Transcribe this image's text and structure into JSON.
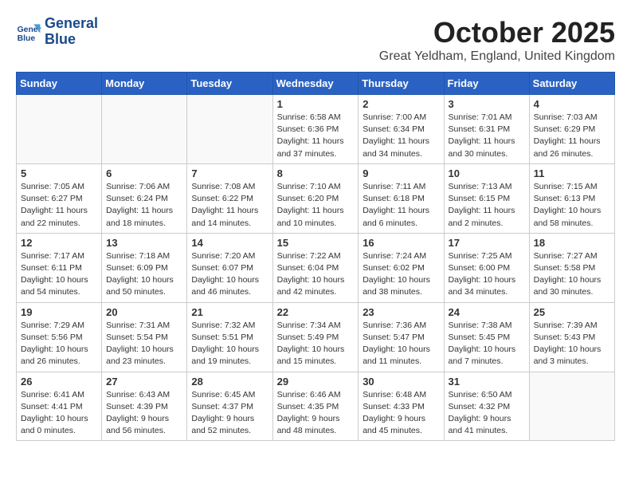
{
  "header": {
    "logo_line1": "General",
    "logo_line2": "Blue",
    "month": "October 2025",
    "location": "Great Yeldham, England, United Kingdom"
  },
  "weekdays": [
    "Sunday",
    "Monday",
    "Tuesday",
    "Wednesday",
    "Thursday",
    "Friday",
    "Saturday"
  ],
  "weeks": [
    [
      {
        "day": "",
        "info": ""
      },
      {
        "day": "",
        "info": ""
      },
      {
        "day": "",
        "info": ""
      },
      {
        "day": "1",
        "info": "Sunrise: 6:58 AM\nSunset: 6:36 PM\nDaylight: 11 hours\nand 37 minutes."
      },
      {
        "day": "2",
        "info": "Sunrise: 7:00 AM\nSunset: 6:34 PM\nDaylight: 11 hours\nand 34 minutes."
      },
      {
        "day": "3",
        "info": "Sunrise: 7:01 AM\nSunset: 6:31 PM\nDaylight: 11 hours\nand 30 minutes."
      },
      {
        "day": "4",
        "info": "Sunrise: 7:03 AM\nSunset: 6:29 PM\nDaylight: 11 hours\nand 26 minutes."
      }
    ],
    [
      {
        "day": "5",
        "info": "Sunrise: 7:05 AM\nSunset: 6:27 PM\nDaylight: 11 hours\nand 22 minutes."
      },
      {
        "day": "6",
        "info": "Sunrise: 7:06 AM\nSunset: 6:24 PM\nDaylight: 11 hours\nand 18 minutes."
      },
      {
        "day": "7",
        "info": "Sunrise: 7:08 AM\nSunset: 6:22 PM\nDaylight: 11 hours\nand 14 minutes."
      },
      {
        "day": "8",
        "info": "Sunrise: 7:10 AM\nSunset: 6:20 PM\nDaylight: 11 hours\nand 10 minutes."
      },
      {
        "day": "9",
        "info": "Sunrise: 7:11 AM\nSunset: 6:18 PM\nDaylight: 11 hours\nand 6 minutes."
      },
      {
        "day": "10",
        "info": "Sunrise: 7:13 AM\nSunset: 6:15 PM\nDaylight: 11 hours\nand 2 minutes."
      },
      {
        "day": "11",
        "info": "Sunrise: 7:15 AM\nSunset: 6:13 PM\nDaylight: 10 hours\nand 58 minutes."
      }
    ],
    [
      {
        "day": "12",
        "info": "Sunrise: 7:17 AM\nSunset: 6:11 PM\nDaylight: 10 hours\nand 54 minutes."
      },
      {
        "day": "13",
        "info": "Sunrise: 7:18 AM\nSunset: 6:09 PM\nDaylight: 10 hours\nand 50 minutes."
      },
      {
        "day": "14",
        "info": "Sunrise: 7:20 AM\nSunset: 6:07 PM\nDaylight: 10 hours\nand 46 minutes."
      },
      {
        "day": "15",
        "info": "Sunrise: 7:22 AM\nSunset: 6:04 PM\nDaylight: 10 hours\nand 42 minutes."
      },
      {
        "day": "16",
        "info": "Sunrise: 7:24 AM\nSunset: 6:02 PM\nDaylight: 10 hours\nand 38 minutes."
      },
      {
        "day": "17",
        "info": "Sunrise: 7:25 AM\nSunset: 6:00 PM\nDaylight: 10 hours\nand 34 minutes."
      },
      {
        "day": "18",
        "info": "Sunrise: 7:27 AM\nSunset: 5:58 PM\nDaylight: 10 hours\nand 30 minutes."
      }
    ],
    [
      {
        "day": "19",
        "info": "Sunrise: 7:29 AM\nSunset: 5:56 PM\nDaylight: 10 hours\nand 26 minutes."
      },
      {
        "day": "20",
        "info": "Sunrise: 7:31 AM\nSunset: 5:54 PM\nDaylight: 10 hours\nand 23 minutes."
      },
      {
        "day": "21",
        "info": "Sunrise: 7:32 AM\nSunset: 5:51 PM\nDaylight: 10 hours\nand 19 minutes."
      },
      {
        "day": "22",
        "info": "Sunrise: 7:34 AM\nSunset: 5:49 PM\nDaylight: 10 hours\nand 15 minutes."
      },
      {
        "day": "23",
        "info": "Sunrise: 7:36 AM\nSunset: 5:47 PM\nDaylight: 10 hours\nand 11 minutes."
      },
      {
        "day": "24",
        "info": "Sunrise: 7:38 AM\nSunset: 5:45 PM\nDaylight: 10 hours\nand 7 minutes."
      },
      {
        "day": "25",
        "info": "Sunrise: 7:39 AM\nSunset: 5:43 PM\nDaylight: 10 hours\nand 3 minutes."
      }
    ],
    [
      {
        "day": "26",
        "info": "Sunrise: 6:41 AM\nSunset: 4:41 PM\nDaylight: 10 hours\nand 0 minutes."
      },
      {
        "day": "27",
        "info": "Sunrise: 6:43 AM\nSunset: 4:39 PM\nDaylight: 9 hours\nand 56 minutes."
      },
      {
        "day": "28",
        "info": "Sunrise: 6:45 AM\nSunset: 4:37 PM\nDaylight: 9 hours\nand 52 minutes."
      },
      {
        "day": "29",
        "info": "Sunrise: 6:46 AM\nSunset: 4:35 PM\nDaylight: 9 hours\nand 48 minutes."
      },
      {
        "day": "30",
        "info": "Sunrise: 6:48 AM\nSunset: 4:33 PM\nDaylight: 9 hours\nand 45 minutes."
      },
      {
        "day": "31",
        "info": "Sunrise: 6:50 AM\nSunset: 4:32 PM\nDaylight: 9 hours\nand 41 minutes."
      },
      {
        "day": "",
        "info": ""
      }
    ]
  ]
}
